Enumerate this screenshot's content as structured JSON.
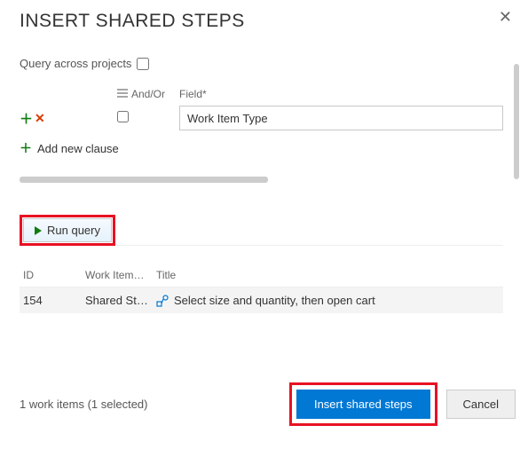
{
  "dialog": {
    "title": "INSERT SHARED STEPS"
  },
  "query": {
    "across_projects_label": "Query across projects",
    "across_projects_checked": false,
    "headers": {
      "andor": "And/Or",
      "field": "Field*"
    },
    "row": {
      "field_value": "Work Item Type"
    },
    "add_clause_label": "Add new clause"
  },
  "run_button_label": "Run query",
  "results": {
    "headers": {
      "id": "ID",
      "type": "Work Item…",
      "title": "Title"
    },
    "rows": [
      {
        "id": "154",
        "type": "Shared St…",
        "title": "Select size and quantity, then open cart"
      }
    ]
  },
  "footer": {
    "status": "1 work items (1 selected)",
    "insert_label": "Insert shared steps",
    "cancel_label": "Cancel"
  }
}
